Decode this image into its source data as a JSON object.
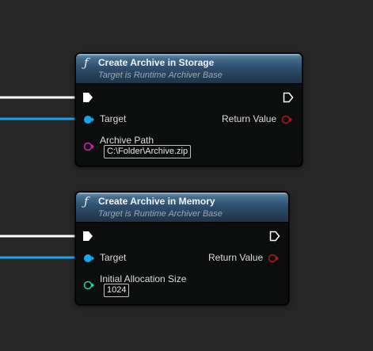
{
  "nodes": [
    {
      "title": "Create Archive in Storage",
      "subtitle": "Target is Runtime Archiver Base",
      "target_label": "Target",
      "return_label": "Return Value",
      "param_label": "Archive Path",
      "param_value": "C:\\Folder\\Archive.zip",
      "param_pin_color": "#d61fb6"
    },
    {
      "title": "Create Archive in Memory",
      "subtitle": "Target is Runtime Archiver Base",
      "target_label": "Target",
      "return_label": "Return Value",
      "param_label": "Initial Allocation Size",
      "param_value": "1024",
      "param_pin_color": "#20d98c"
    }
  ],
  "colors": {
    "background": "#262626",
    "exec_wire": "#ffffff",
    "object_wire": "#1aa5e8",
    "return_pin": "#b01818",
    "header": "#2f5070"
  },
  "icons": {
    "function": "italic-f-function-icon",
    "exec_in": "exec-pin-filled",
    "exec_out": "exec-pin-outline",
    "target": "object-pin-filled",
    "return": "object-pin-outline",
    "param_string": "string-pin-outline",
    "param_int": "integer-pin-outline"
  },
  "function_glyph": "ƒ"
}
